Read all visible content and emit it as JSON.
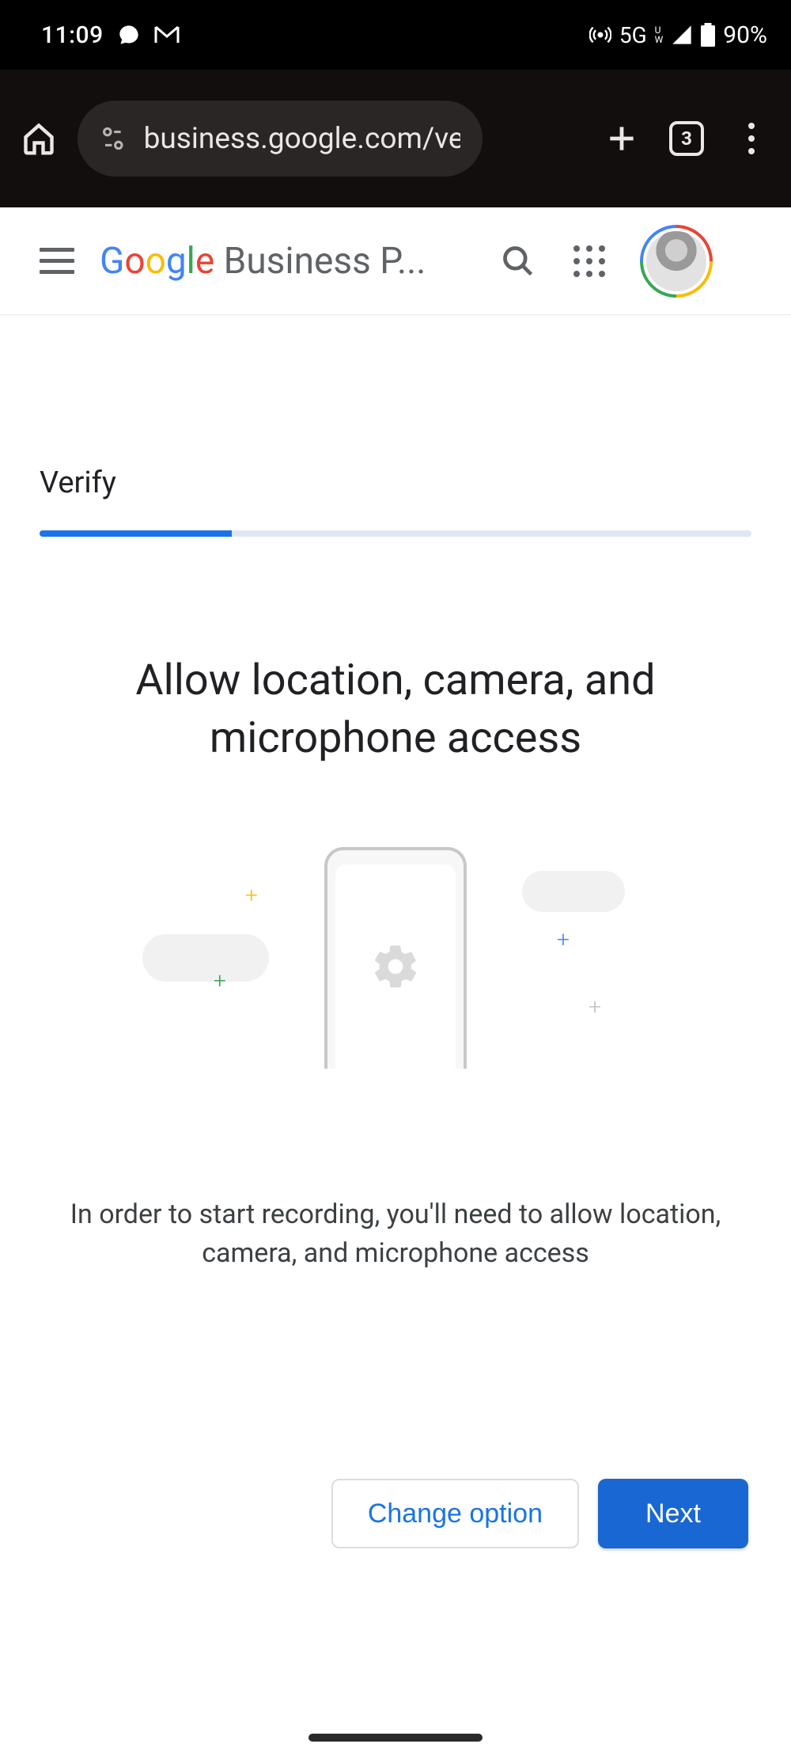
{
  "status_bar": {
    "time": "11:09",
    "network_label": "5G",
    "network_sub": "U\nW",
    "battery_percent": "90%"
  },
  "chrome": {
    "url": "business.google.com/ve",
    "tab_count": "3"
  },
  "header": {
    "brand_rest": " Business P..."
  },
  "content": {
    "step_title": "Verify",
    "progress_percent": 27,
    "headline": "Allow location, camera, and microphone access",
    "body": "In order to start recording, you'll need to allow location, camera, and microphone access",
    "change_option": "Change option",
    "next": "Next"
  }
}
